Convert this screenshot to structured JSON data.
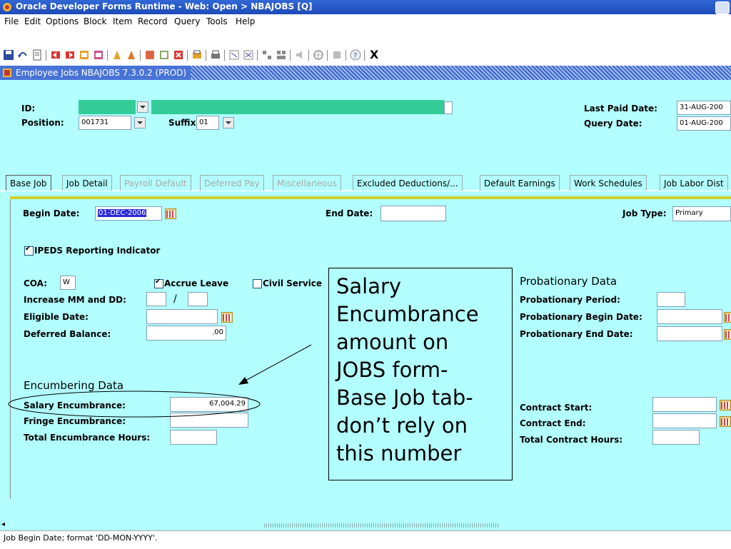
{
  "window": {
    "title": "Oracle Developer Forms Runtime - Web:  Open > NBAJOBS [Q]"
  },
  "menu": [
    "File",
    "Edit",
    "Options",
    "Block",
    "Item",
    "Record",
    "Query",
    "Tools",
    "Help"
  ],
  "toolbar": {
    "exit_label": "X"
  },
  "form": {
    "title": "Employee Jobs  NBAJOBS  7.3.0.2  (PROD)"
  },
  "header": {
    "id_label": "ID:",
    "position_label": "Position:",
    "position_value": "001731",
    "suffix_label": "Suffix:",
    "suffix_value": "01",
    "last_paid_label": "Last Paid Date:",
    "last_paid_value": "31-AUG-200",
    "query_date_label": "Query Date:",
    "query_date_value": "01-AUG-200"
  },
  "tabs": [
    {
      "label": "Base Job",
      "state": "active"
    },
    {
      "label": "Job Detail",
      "state": "enabled"
    },
    {
      "label": "Payroll Default",
      "state": "disabled"
    },
    {
      "label": "Deferred Pay",
      "state": "disabled"
    },
    {
      "label": "Miscellaneous",
      "state": "disabled"
    },
    {
      "label": "Excluded Deductions/...",
      "state": "enabled"
    },
    {
      "label": "Default Earnings",
      "state": "enabled"
    },
    {
      "label": "Work Schedules",
      "state": "enabled"
    },
    {
      "label": "Job Labor Dist",
      "state": "enabled"
    }
  ],
  "base_job": {
    "begin_date_label": "Begin Date:",
    "begin_date_value": "01-DEC-2006",
    "end_date_label": "End Date:",
    "end_date_value": "",
    "job_type_label": "Job Type:",
    "job_type_value": "Primary",
    "ipeds_label": "IPEDS Reporting  Indicator",
    "coa_label": "COA:",
    "coa_value": "W",
    "accrue_leave_label": "Accrue Leave",
    "civil_service_label": "Civil Service",
    "increase_label": "Increase MM and DD:",
    "increase_sep": "/",
    "eligible_label": "Eligible Date:",
    "deferred_label": "Deferred Balance:",
    "deferred_value": ".00",
    "encumbering_title": "Encumbering Data",
    "salary_enc_label": "Salary Encumbrance:",
    "salary_enc_value": "67,004.29",
    "fringe_enc_label": "Fringe Encumbrance:",
    "total_enc_hours_label": "Total Encumbrance Hours:",
    "prob_title": "Probationary Data",
    "prob_period_label": "Probationary Period:",
    "prob_begin_label": "Probationary Begin Date:",
    "prob_end_label": "Probationary End Date:",
    "contract_start_label": "Contract Start:",
    "contract_end_label": "Contract End:",
    "total_contract_label": "Total Contract Hours:"
  },
  "callout": {
    "lines": [
      "Salary",
      "Encumbrance",
      "amount on",
      "JOBS form-",
      "Base Job tab-",
      "don’t rely on",
      "this number"
    ]
  },
  "status": {
    "message": "Job Begin Date; format 'DD-MON-YYYY'."
  },
  "colors": {
    "form_bg": "#b3ffff",
    "highlight": "#33cc99",
    "title_blue": "#2458c8"
  }
}
